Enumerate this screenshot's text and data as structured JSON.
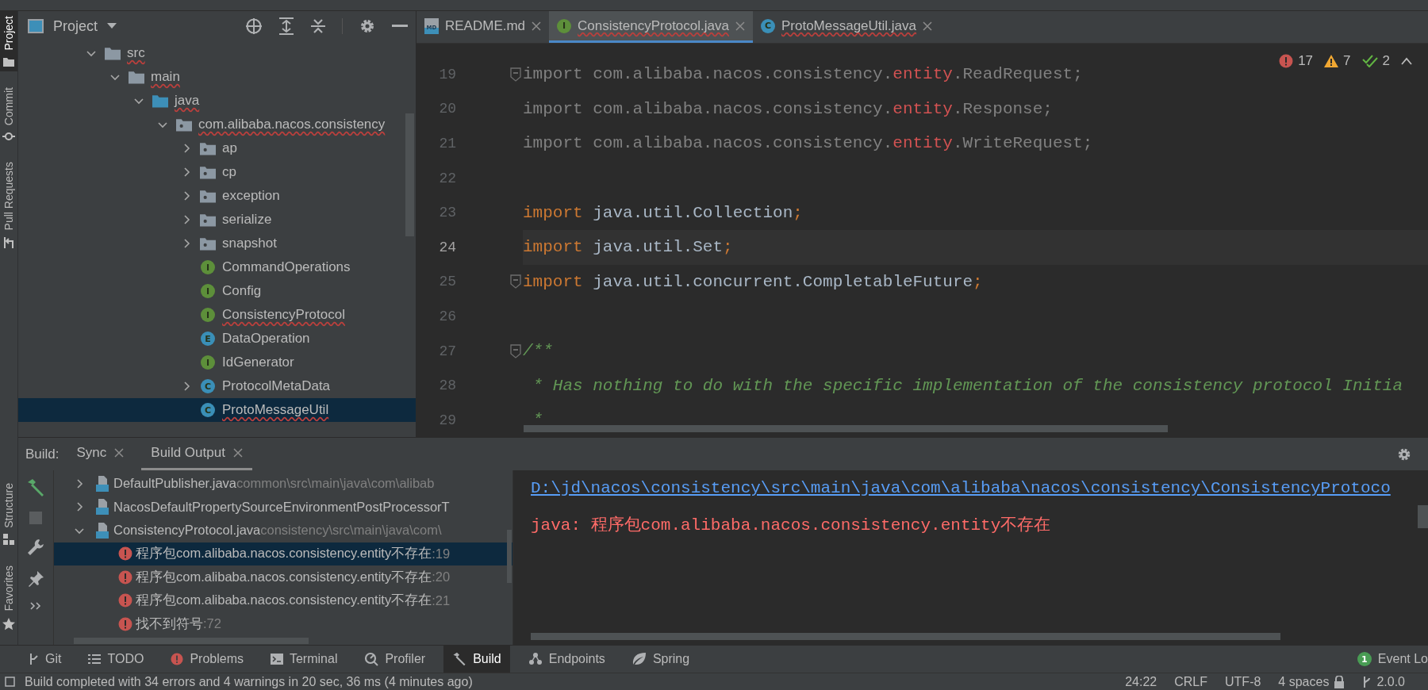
{
  "tool_windows_left": [
    {
      "label": "Project",
      "kind": "project",
      "selected": true
    },
    {
      "label": "Commit",
      "kind": "commit",
      "selected": false
    },
    {
      "label": "Pull Requests",
      "kind": "pull_requests",
      "selected": false
    }
  ],
  "tool_windows_left_bottom": [
    {
      "label": "Structure",
      "kind": "structure"
    },
    {
      "label": "Favorites",
      "kind": "favorites"
    }
  ],
  "project_panel": {
    "title": "Project",
    "tree": [
      {
        "label": "src",
        "kind": "folder",
        "expanded": true,
        "selected": false,
        "error": true,
        "children": [
          {
            "label": "main",
            "kind": "folder",
            "expanded": true,
            "selected": false,
            "error": true,
            "children": [
              {
                "label": "java",
                "kind": "source_root",
                "expanded": true,
                "selected": false,
                "error": true,
                "children": [
                  {
                    "label": "com.alibaba.nacos.consistency",
                    "kind": "package",
                    "expanded": true,
                    "selected": false,
                    "error": true,
                    "children": [
                      {
                        "label": "ap",
                        "kind": "package",
                        "expanded": false,
                        "selected": false,
                        "error": false
                      },
                      {
                        "label": "cp",
                        "kind": "package",
                        "expanded": false,
                        "selected": false,
                        "error": false
                      },
                      {
                        "label": "exception",
                        "kind": "package",
                        "expanded": false,
                        "selected": false,
                        "error": false
                      },
                      {
                        "label": "serialize",
                        "kind": "package",
                        "expanded": false,
                        "selected": false,
                        "error": false
                      },
                      {
                        "label": "snapshot",
                        "kind": "package",
                        "expanded": false,
                        "selected": false,
                        "error": false
                      },
                      {
                        "label": "CommandOperations",
                        "kind": "interface",
                        "icon_letter": "I",
                        "selected": false,
                        "error": false
                      },
                      {
                        "label": "Config",
                        "kind": "interface",
                        "icon_letter": "I",
                        "selected": false,
                        "error": false
                      },
                      {
                        "label": "ConsistencyProtocol",
                        "kind": "interface",
                        "icon_letter": "I",
                        "selected": false,
                        "error": true
                      },
                      {
                        "label": "DataOperation",
                        "kind": "enum",
                        "icon_letter": "E",
                        "selected": false,
                        "error": false
                      },
                      {
                        "label": "IdGenerator",
                        "kind": "interface",
                        "icon_letter": "I",
                        "selected": false,
                        "error": false
                      },
                      {
                        "label": "ProtocolMetaData",
                        "kind": "class",
                        "icon_letter": "C",
                        "expanded": false,
                        "selected": false,
                        "error": false
                      },
                      {
                        "label": "ProtoMessageUtil",
                        "kind": "class",
                        "icon_letter": "C",
                        "selected": true,
                        "error": true
                      }
                    ]
                  }
                ]
              }
            ]
          }
        ]
      }
    ]
  },
  "editor": {
    "tabs": [
      {
        "label": "README.md",
        "kind": "markdown",
        "icon_letter": "MD",
        "selected": false,
        "error": false
      },
      {
        "label": "ConsistencyProtocol.java",
        "kind": "interface",
        "icon_letter": "I",
        "selected": true,
        "error": true
      },
      {
        "label": "ProtoMessageUtil.java",
        "kind": "class",
        "icon_letter": "C",
        "selected": false,
        "error": true
      }
    ],
    "inspections": {
      "errors": "17",
      "warnings": "7",
      "weak_warnings": "2"
    },
    "lines": [
      {
        "number": "19",
        "fold": true,
        "current": false,
        "tokens": [
          {
            "text": "import com.alibaba.nacos.consistency.",
            "kind": "unused"
          },
          {
            "text": "entity",
            "kind": "unresolved"
          },
          {
            "text": ".ReadRequest;",
            "kind": "unused"
          }
        ]
      },
      {
        "number": "20",
        "fold": false,
        "current": false,
        "tokens": [
          {
            "text": "import com.alibaba.nacos.consistency.",
            "kind": "unused"
          },
          {
            "text": "entity",
            "kind": "unresolved"
          },
          {
            "text": ".Response;",
            "kind": "unused"
          }
        ]
      },
      {
        "number": "21",
        "fold": false,
        "current": false,
        "tokens": [
          {
            "text": "import com.alibaba.nacos.consistency.",
            "kind": "unused"
          },
          {
            "text": "entity",
            "kind": "unresolved"
          },
          {
            "text": ".WriteRequest;",
            "kind": "unused"
          }
        ]
      },
      {
        "number": "22",
        "fold": false,
        "current": false
      },
      {
        "number": "23",
        "fold": false,
        "current": false,
        "tokens": [
          {
            "text": "import",
            "kind": "keyword"
          },
          {
            "text": " java.util.Collection",
            "kind": "plain"
          },
          {
            "text": ";",
            "kind": "keyword"
          }
        ]
      },
      {
        "number": "24",
        "fold": false,
        "current": true,
        "tokens": [
          {
            "text": "import",
            "kind": "keyword"
          },
          {
            "text": " java.util.Set",
            "kind": "plain"
          },
          {
            "text": ";",
            "kind": "keyword"
          }
        ]
      },
      {
        "number": "25",
        "fold": true,
        "current": false,
        "tokens": [
          {
            "text": "import",
            "kind": "keyword"
          },
          {
            "text": " java.util.concurrent.CompletableFuture",
            "kind": "plain"
          },
          {
            "text": ";",
            "kind": "keyword"
          }
        ]
      },
      {
        "number": "26",
        "fold": false,
        "current": false
      },
      {
        "number": "27",
        "fold": true,
        "current": false,
        "tokens": [
          {
            "text": "/**",
            "kind": "comment"
          }
        ]
      },
      {
        "number": "28",
        "fold": false,
        "current": false,
        "tokens": [
          {
            "text": " * Has nothing to do with the specific implementation of the consistency protocol Initia",
            "kind": "comment"
          }
        ]
      },
      {
        "number": "29",
        "fold": false,
        "current": false,
        "tokens": [
          {
            "text": " *",
            "kind": "comment"
          }
        ]
      }
    ]
  },
  "build_panel": {
    "label": "Build:",
    "tabs": [
      {
        "label": "Sync",
        "selected": false
      },
      {
        "label": "Build Output",
        "selected": true
      }
    ],
    "tree": [
      {
        "kind": "file",
        "name": "DefaultPublisher.java",
        "path": "common\\src\\main\\java\\com\\alibab",
        "expanded": false,
        "selected": false
      },
      {
        "kind": "file",
        "name": "NacosDefaultPropertySourceEnvironmentPostProcessorT",
        "expanded": false,
        "selected": false
      },
      {
        "kind": "file",
        "name": "ConsistencyProtocol.java",
        "path": "consistency\\src\\main\\java\\com\\",
        "expanded": true,
        "selected": false,
        "children": [
          {
            "kind": "error",
            "text": "程序包com.alibaba.nacos.consistency.entity不存在",
            "line": ":19",
            "selected": true
          },
          {
            "kind": "error",
            "text": "程序包com.alibaba.nacos.consistency.entity不存在",
            "line": ":20",
            "selected": false
          },
          {
            "kind": "error",
            "text": "程序包com.alibaba.nacos.consistency.entity不存在",
            "line": ":21",
            "selected": false
          },
          {
            "kind": "error",
            "text": "找不到符号",
            "line": ":72",
            "selected": false
          }
        ]
      }
    ],
    "output": {
      "link": "D:\\jd\\nacos\\consistency\\src\\main\\java\\com\\alibaba\\nacos\\consistency\\ConsistencyProtoco",
      "message": "java: 程序包com.alibaba.nacos.consistency.entity不存在"
    }
  },
  "tool_window_bar": [
    {
      "label": "Git",
      "kind": "git",
      "selected": false
    },
    {
      "label": "TODO",
      "kind": "todo",
      "selected": false
    },
    {
      "label": "Problems",
      "kind": "problems",
      "selected": false
    },
    {
      "label": "Terminal",
      "kind": "terminal",
      "selected": false
    },
    {
      "label": "Profiler",
      "kind": "profiler",
      "selected": false
    },
    {
      "label": "Build",
      "kind": "build",
      "selected": true
    },
    {
      "label": "Endpoints",
      "kind": "endpoints",
      "selected": false
    },
    {
      "label": "Spring",
      "kind": "spring",
      "selected": false
    },
    {
      "label": "Event Lo",
      "kind": "event_log",
      "badge": "1",
      "selected": false
    }
  ],
  "status_bar": {
    "message": "Build completed with 34 errors and 4 warnings in 20 sec, 36 ms (4 minutes ago)",
    "position": "24:22",
    "line_separator": "CRLF",
    "encoding": "UTF-8",
    "indent": "4 spaces",
    "branch": "2.0.0"
  }
}
